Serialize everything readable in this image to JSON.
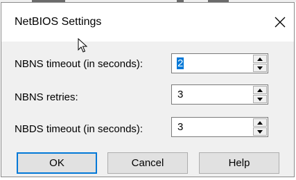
{
  "dialog": {
    "title": "NetBIOS Settings",
    "close_icon": "close-icon"
  },
  "fields": [
    {
      "label": "NBNS timeout (in seconds):",
      "value": "2",
      "selected": true
    },
    {
      "label": "NBNS retries:",
      "value": "3",
      "selected": false
    },
    {
      "label": "NBDS timeout (in seconds):",
      "value": "3",
      "selected": false
    }
  ],
  "buttons": {
    "ok": "OK",
    "cancel": "Cancel",
    "help": "Help"
  },
  "colors": {
    "selection": "#0078d7",
    "dialog_bg": "#f0f0f0",
    "button_bg": "#e1e1e1"
  }
}
